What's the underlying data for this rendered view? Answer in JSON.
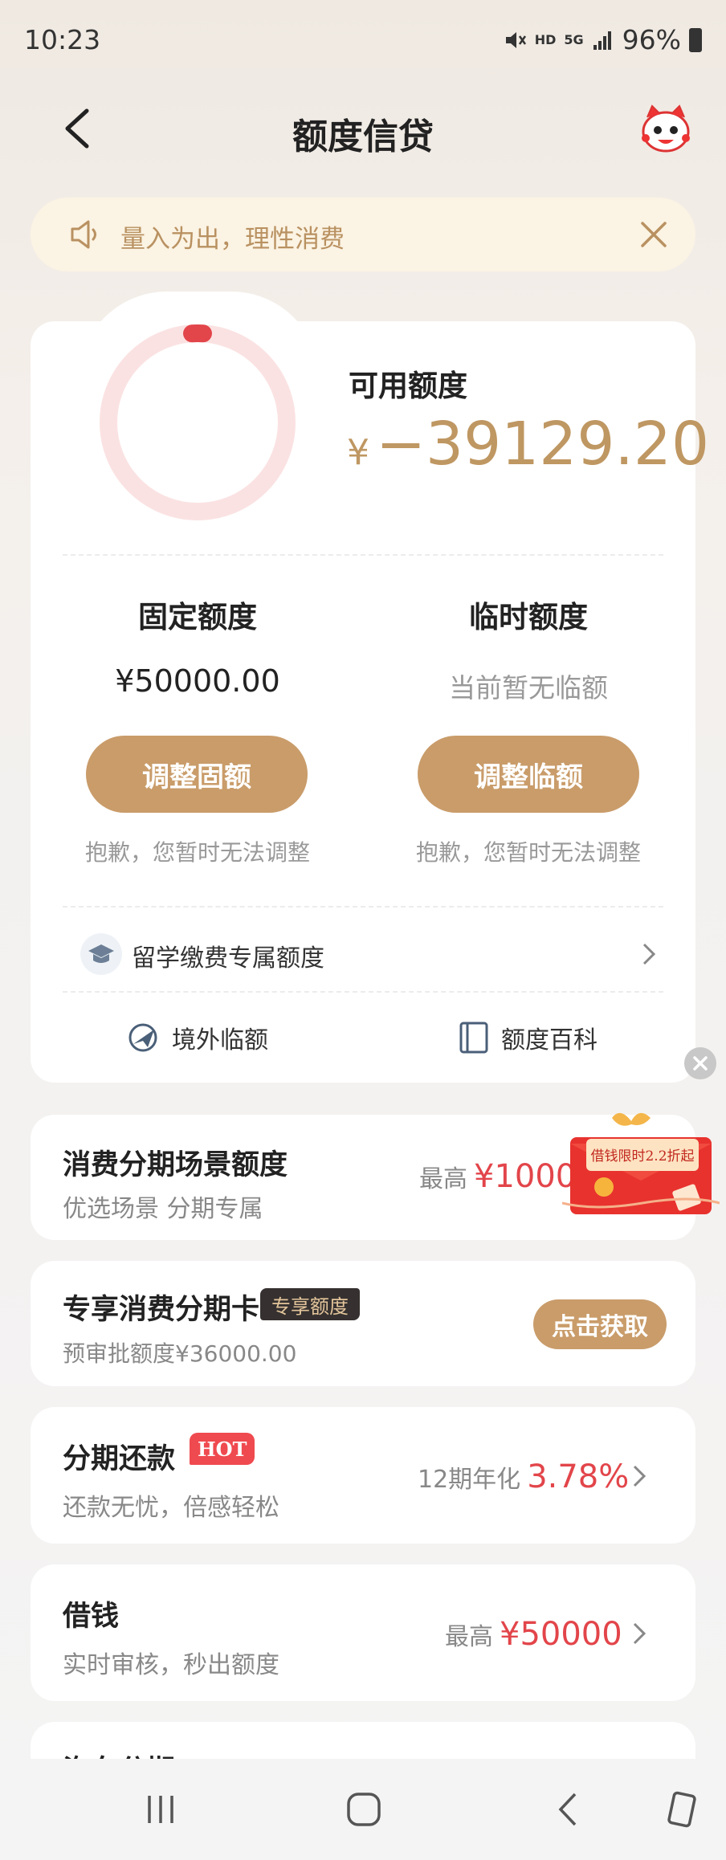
{
  "status": {
    "time": "10:23",
    "hd": "HD",
    "network": "5G",
    "battery": "96%"
  },
  "nav": {
    "title": "额度信贷"
  },
  "notice": {
    "text": "量入为出，理性消费"
  },
  "credit": {
    "available_label": "可用额度",
    "yen": "¥",
    "available_amount": "−39129.20",
    "ring_progress": 0.02,
    "ring_color": "#e2454a",
    "ring_track_color": "#fbe2e2"
  },
  "fixed": {
    "title": "固定额度",
    "value": "¥50000.00",
    "button": "调整固额",
    "note": "抱歉，您暂时无法调整"
  },
  "temp": {
    "title": "临时额度",
    "value": "当前暂无临额",
    "button": "调整临额",
    "note": "抱歉，您暂时无法调整"
  },
  "study": {
    "label": "留学缴费专属额度"
  },
  "links": {
    "overseas": "境外临额",
    "wiki": "额度百科"
  },
  "cards": {
    "scene": {
      "title": "消费分期场景额度",
      "sub": "优选场景 分期专属",
      "prefix": "最高",
      "value": "¥1000"
    },
    "exclusive": {
      "title": "专享消费分期卡",
      "badge": "专享额度",
      "sub": "预审批额度¥36000.00",
      "button": "点击获取"
    },
    "installment": {
      "title": "分期还款",
      "badge": "HOT",
      "sub": "还款无忧，倍感轻松",
      "prefix": "12期年化",
      "value": "3.78%"
    },
    "borrow": {
      "title": "借钱",
      "sub": "实时审核，秒出额度",
      "prefix": "最高",
      "value": "¥50000"
    },
    "partial": {
      "title": "汽车分期"
    }
  },
  "promo": {
    "text": "借钱限时2.2折起"
  },
  "colors": {
    "accent": "#c99c6a",
    "gold_text": "#bf9762",
    "red": "#e2454a"
  }
}
